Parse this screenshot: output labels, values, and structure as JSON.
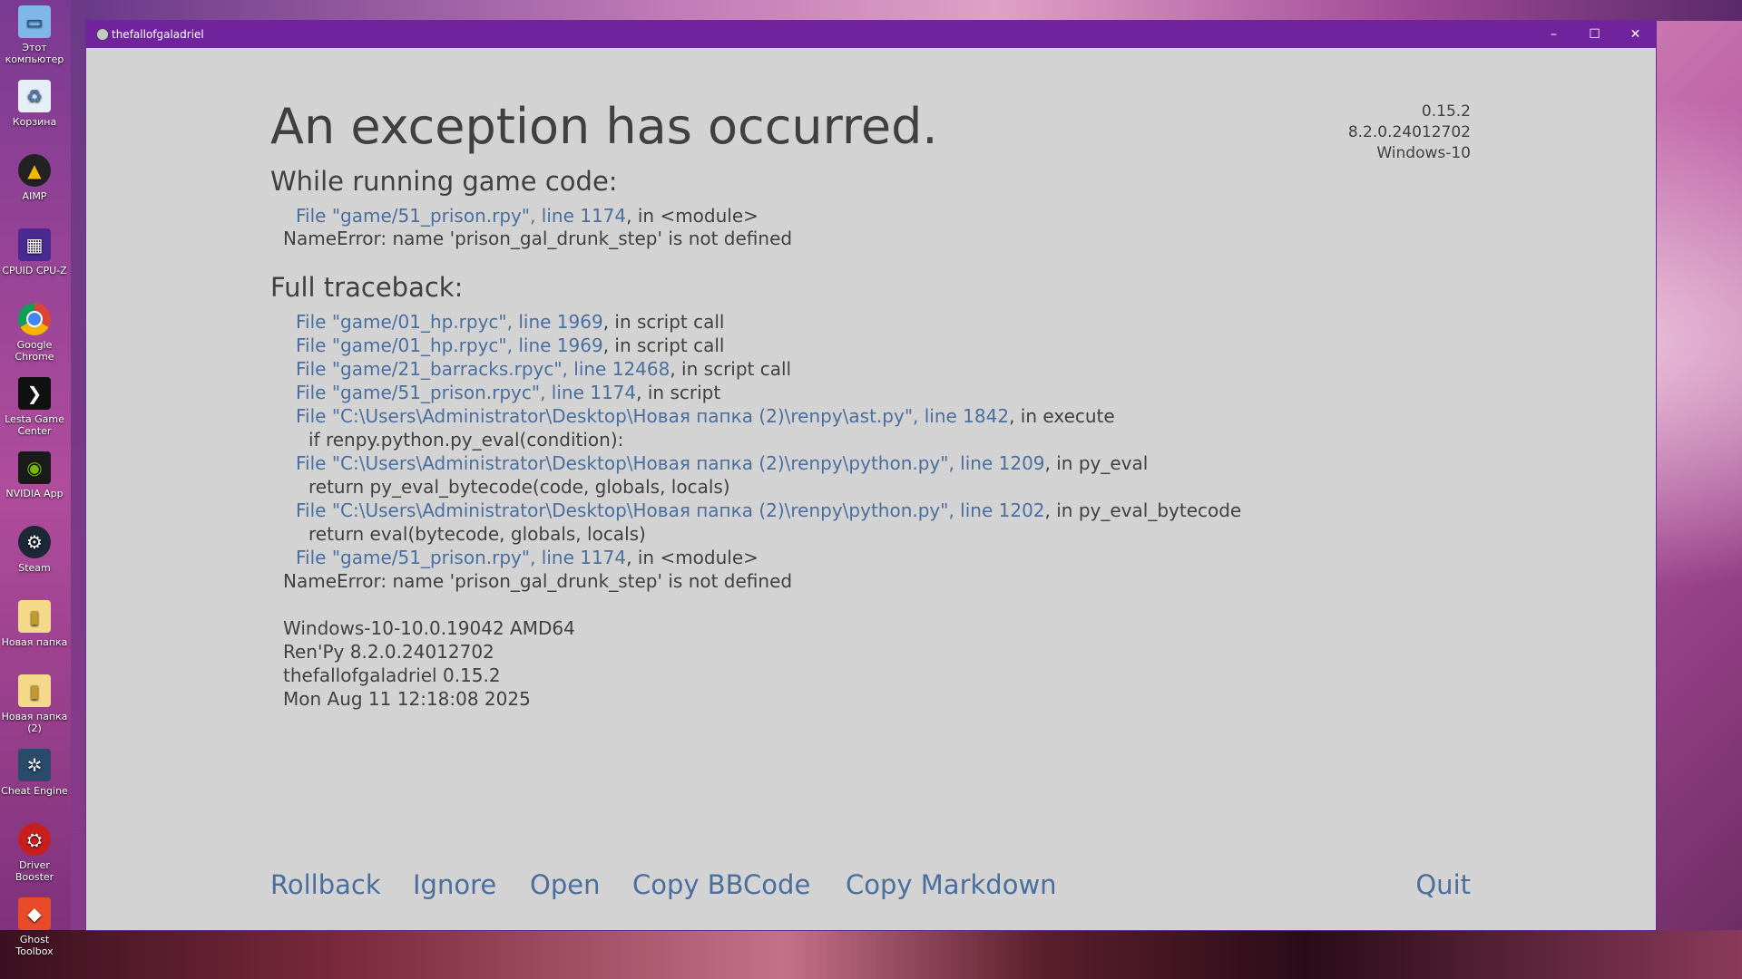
{
  "desktop": {
    "icons": [
      {
        "label": "Этот компьютер",
        "icon": "computer-icon"
      },
      {
        "label": "Корзина",
        "icon": "recycle-bin-icon"
      },
      {
        "label": "AIMP",
        "icon": "aimp-icon"
      },
      {
        "label": "CPUID CPU-Z",
        "icon": "cpuz-icon"
      },
      {
        "label": "Google Chrome",
        "icon": "chrome-icon"
      },
      {
        "label": "Lesta Game Center",
        "icon": "lesta-icon"
      },
      {
        "label": "NVIDIA App",
        "icon": "nvidia-icon"
      },
      {
        "label": "Steam",
        "icon": "steam-icon"
      },
      {
        "label": "Новая папка",
        "icon": "folder-icon"
      },
      {
        "label": "Новая папка (2)",
        "icon": "folder-icon"
      },
      {
        "label": "Cheat Engine",
        "icon": "cheat-engine-icon"
      },
      {
        "label": "Driver Booster",
        "icon": "driver-booster-icon"
      },
      {
        "label": "Ghost Toolbox",
        "icon": "ghost-toolbox-icon"
      }
    ]
  },
  "window": {
    "title": "thefallofgaladriel",
    "minimize": "–",
    "maximize": "☐",
    "close": "✕"
  },
  "exception": {
    "heading": "An exception has occurred.",
    "version_lines": [
      "0.15.2",
      "8.2.0.24012702",
      "Windows-10"
    ],
    "while_running_title": "While running game code:",
    "while_running": [
      {
        "kind": "loc",
        "loc": "File \"game/51_prison.rpy\", line 1174",
        "rest": ", in <module>"
      },
      {
        "kind": "err",
        "text": "NameError: name 'prison_gal_drunk_step' is not defined"
      }
    ],
    "full_traceback_title": "Full traceback:",
    "full_traceback": [
      {
        "kind": "loc",
        "loc": "File \"game/01_hp.rpyc\", line 1969",
        "rest": ", in script call"
      },
      {
        "kind": "loc",
        "loc": "File \"game/01_hp.rpyc\", line 1969",
        "rest": ", in script call"
      },
      {
        "kind": "loc",
        "loc": "File \"game/21_barracks.rpyc\", line 12468",
        "rest": ", in script call"
      },
      {
        "kind": "loc",
        "loc": "File \"game/51_prison.rpyc\", line 1174",
        "rest": ", in script"
      },
      {
        "kind": "loc",
        "loc": "File \"C:\\Users\\Administrator\\Desktop\\Новая папка (2)\\renpy\\ast.py\", line 1842",
        "rest": ", in execute"
      },
      {
        "kind": "code",
        "text": "if renpy.python.py_eval(condition):"
      },
      {
        "kind": "loc",
        "loc": "File \"C:\\Users\\Administrator\\Desktop\\Новая папка (2)\\renpy\\python.py\", line 1209",
        "rest": ", in py_eval"
      },
      {
        "kind": "code",
        "text": "return py_eval_bytecode(code, globals, locals)"
      },
      {
        "kind": "loc",
        "loc": "File \"C:\\Users\\Administrator\\Desktop\\Новая папка (2)\\renpy\\python.py\", line 1202",
        "rest": ", in py_eval_bytecode"
      },
      {
        "kind": "code",
        "text": "return eval(bytecode, globals, locals)"
      },
      {
        "kind": "loc",
        "loc": "File \"game/51_prison.rpy\", line 1174",
        "rest": ", in <module>"
      },
      {
        "kind": "err",
        "text": "NameError: name 'prison_gal_drunk_step' is not defined"
      }
    ],
    "system_info": [
      "Windows-10-10.0.19042 AMD64",
      "Ren'Py 8.2.0.24012702",
      "thefallofgaladriel 0.15.2",
      "Mon Aug 11 12:18:08 2025"
    ]
  },
  "actions": {
    "rollback": "Rollback",
    "ignore": "Ignore",
    "open": "Open",
    "copy_bbcode": "Copy BBCode",
    "copy_markdown": "Copy Markdown",
    "quit": "Quit"
  }
}
